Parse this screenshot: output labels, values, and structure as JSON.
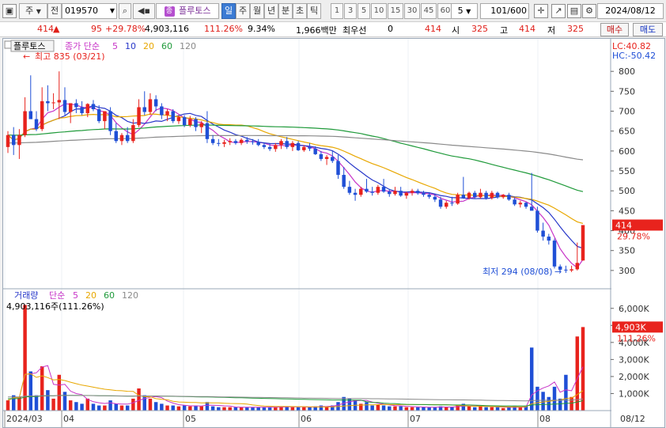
{
  "toolbar": {
    "market_label": "주",
    "prev_label": "전",
    "stock_code": "019570",
    "stock_badge": "종",
    "stock_name": "플루토스",
    "periods": [
      "일",
      "주",
      "월",
      "년",
      "분",
      "초",
      "틱"
    ],
    "active_period": "일",
    "intervals": [
      "1",
      "3",
      "5",
      "10",
      "15",
      "30",
      "45",
      "60"
    ],
    "interval_value": "5",
    "count_value": "101",
    "count_total": "/600",
    "date_value": "2024/08/12"
  },
  "quote": {
    "price": "414",
    "change": "95",
    "change_pct": "+29.78%",
    "volume": "4,903,116",
    "volume_pct": "111.26%",
    "turnover_pct": "9.34%",
    "amount": "1,966백만",
    "pref_label": "최우선",
    "pref_value": "0",
    "bid": "414",
    "open_label": "시",
    "open_value": "325",
    "high_label": "고",
    "high_value": "414",
    "low_label": "저",
    "low_value": "325",
    "buy_button": "매수",
    "sell_button": "매도"
  },
  "price_panel": {
    "legend_name": "플루토스",
    "legend_ma_title": "종가 단순",
    "legend_ma": [
      "5",
      "10",
      "20",
      "60",
      "120"
    ],
    "max_note": "최고 835 (03/21)",
    "min_note": "최저 294 (08/08)",
    "lc_label": "LC:40.82",
    "hc_label": "HC:-50.42",
    "current_price_tag": "414",
    "current_pct_tag": "29.78%"
  },
  "volume_panel": {
    "legend_title": "거래량",
    "legend_ma_title": "단순",
    "legend_ma": [
      "5",
      "20",
      "60",
      "120"
    ],
    "volume_note": "4,903,116주(111.26%)",
    "current_volume_tag": "4,903K",
    "current_pct_tag": "111.26%"
  },
  "colors": {
    "up": "#e8231d",
    "down": "#1f4fd6",
    "ma5": "#c733c7",
    "ma10": "#2737c9",
    "ma20": "#e8a700",
    "ma60": "#1f9a3a",
    "ma120": "#8a8a8a"
  },
  "chart_data": {
    "type": "candlestick",
    "price_axis": {
      "ticks": [
        "300",
        "350",
        "400",
        "450",
        "500",
        "550",
        "600",
        "650",
        "700",
        "750",
        "800"
      ],
      "ylim": [
        262,
        858
      ]
    },
    "volume_axis": {
      "ticks": [
        "1,000K",
        "2,000K",
        "3,000K",
        "4,000K",
        "5,000K",
        "6,000K"
      ],
      "ylim": [
        0,
        6500000
      ]
    },
    "x_ticks": [
      "2024/03",
      "04",
      "05",
      "06",
      "07",
      "08",
      "08/12"
    ],
    "candles": [
      {
        "o": 610,
        "h": 650,
        "l": 595,
        "c": 640,
        "v": 600000
      },
      {
        "o": 640,
        "h": 660,
        "l": 590,
        "c": 615,
        "v": 900000
      },
      {
        "o": 615,
        "h": 655,
        "l": 580,
        "c": 640,
        "v": 800000
      },
      {
        "o": 640,
        "h": 735,
        "l": 635,
        "c": 700,
        "v": 6200000
      },
      {
        "o": 700,
        "h": 790,
        "l": 690,
        "c": 680,
        "v": 2300000
      },
      {
        "o": 680,
        "h": 700,
        "l": 650,
        "c": 655,
        "v": 900000
      },
      {
        "o": 655,
        "h": 760,
        "l": 650,
        "c": 725,
        "v": 2600000
      },
      {
        "o": 725,
        "h": 765,
        "l": 700,
        "c": 720,
        "v": 1200000
      },
      {
        "o": 720,
        "h": 745,
        "l": 705,
        "c": 722,
        "v": 700000
      },
      {
        "o": 722,
        "h": 800,
        "l": 680,
        "c": 728,
        "v": 2100000
      },
      {
        "o": 728,
        "h": 760,
        "l": 690,
        "c": 698,
        "v": 1100000
      },
      {
        "o": 698,
        "h": 720,
        "l": 670,
        "c": 720,
        "v": 600000
      },
      {
        "o": 720,
        "h": 730,
        "l": 695,
        "c": 710,
        "v": 500000
      },
      {
        "o": 710,
        "h": 725,
        "l": 690,
        "c": 695,
        "v": 400000
      },
      {
        "o": 695,
        "h": 720,
        "l": 685,
        "c": 718,
        "v": 700000
      },
      {
        "o": 718,
        "h": 728,
        "l": 700,
        "c": 705,
        "v": 400000
      },
      {
        "o": 705,
        "h": 715,
        "l": 670,
        "c": 675,
        "v": 300000
      },
      {
        "o": 675,
        "h": 700,
        "l": 655,
        "c": 700,
        "v": 300000
      },
      {
        "o": 700,
        "h": 710,
        "l": 640,
        "c": 650,
        "v": 600000
      },
      {
        "o": 650,
        "h": 670,
        "l": 620,
        "c": 625,
        "v": 400000
      },
      {
        "o": 625,
        "h": 645,
        "l": 615,
        "c": 640,
        "v": 300000
      },
      {
        "o": 640,
        "h": 660,
        "l": 620,
        "c": 625,
        "v": 300000
      },
      {
        "o": 625,
        "h": 680,
        "l": 620,
        "c": 665,
        "v": 700000
      },
      {
        "o": 665,
        "h": 730,
        "l": 660,
        "c": 710,
        "v": 1300000
      },
      {
        "o": 710,
        "h": 750,
        "l": 690,
        "c": 698,
        "v": 900000
      },
      {
        "o": 698,
        "h": 745,
        "l": 690,
        "c": 730,
        "v": 700000
      },
      {
        "o": 730,
        "h": 740,
        "l": 700,
        "c": 712,
        "v": 500000
      },
      {
        "o": 712,
        "h": 720,
        "l": 680,
        "c": 690,
        "v": 400000
      },
      {
        "o": 690,
        "h": 705,
        "l": 675,
        "c": 700,
        "v": 300000
      },
      {
        "o": 700,
        "h": 705,
        "l": 670,
        "c": 675,
        "v": 300000
      },
      {
        "o": 675,
        "h": 690,
        "l": 668,
        "c": 685,
        "v": 250000
      },
      {
        "o": 685,
        "h": 690,
        "l": 660,
        "c": 665,
        "v": 300000
      },
      {
        "o": 665,
        "h": 688,
        "l": 660,
        "c": 680,
        "v": 250000
      },
      {
        "o": 680,
        "h": 685,
        "l": 650,
        "c": 660,
        "v": 300000
      },
      {
        "o": 660,
        "h": 675,
        "l": 645,
        "c": 670,
        "v": 250000
      },
      {
        "o": 670,
        "h": 700,
        "l": 620,
        "c": 630,
        "v": 500000
      },
      {
        "o": 630,
        "h": 640,
        "l": 615,
        "c": 620,
        "v": 250000
      },
      {
        "o": 620,
        "h": 630,
        "l": 612,
        "c": 618,
        "v": 200000
      },
      {
        "o": 618,
        "h": 628,
        "l": 610,
        "c": 622,
        "v": 200000
      },
      {
        "o": 622,
        "h": 632,
        "l": 615,
        "c": 625,
        "v": 200000
      },
      {
        "o": 625,
        "h": 630,
        "l": 616,
        "c": 620,
        "v": 200000
      },
      {
        "o": 620,
        "h": 632,
        "l": 615,
        "c": 628,
        "v": 200000
      },
      {
        "o": 628,
        "h": 635,
        "l": 618,
        "c": 624,
        "v": 200000
      },
      {
        "o": 624,
        "h": 630,
        "l": 616,
        "c": 622,
        "v": 200000
      },
      {
        "o": 622,
        "h": 630,
        "l": 612,
        "c": 615,
        "v": 200000
      },
      {
        "o": 615,
        "h": 622,
        "l": 605,
        "c": 610,
        "v": 200000
      },
      {
        "o": 610,
        "h": 618,
        "l": 600,
        "c": 605,
        "v": 200000
      },
      {
        "o": 605,
        "h": 620,
        "l": 598,
        "c": 615,
        "v": 200000
      },
      {
        "o": 615,
        "h": 630,
        "l": 605,
        "c": 625,
        "v": 250000
      },
      {
        "o": 625,
        "h": 635,
        "l": 605,
        "c": 610,
        "v": 250000
      },
      {
        "o": 610,
        "h": 625,
        "l": 600,
        "c": 620,
        "v": 200000
      },
      {
        "o": 620,
        "h": 625,
        "l": 600,
        "c": 602,
        "v": 200000
      },
      {
        "o": 602,
        "h": 615,
        "l": 598,
        "c": 610,
        "v": 200000
      },
      {
        "o": 610,
        "h": 620,
        "l": 600,
        "c": 606,
        "v": 200000
      },
      {
        "o": 606,
        "h": 612,
        "l": 590,
        "c": 592,
        "v": 250000
      },
      {
        "o": 592,
        "h": 600,
        "l": 575,
        "c": 580,
        "v": 300000
      },
      {
        "o": 580,
        "h": 590,
        "l": 565,
        "c": 585,
        "v": 250000
      },
      {
        "o": 585,
        "h": 600,
        "l": 570,
        "c": 575,
        "v": 300000
      },
      {
        "o": 575,
        "h": 590,
        "l": 530,
        "c": 540,
        "v": 500000
      },
      {
        "o": 540,
        "h": 560,
        "l": 505,
        "c": 510,
        "v": 800000
      },
      {
        "o": 510,
        "h": 525,
        "l": 490,
        "c": 495,
        "v": 700000
      },
      {
        "o": 495,
        "h": 505,
        "l": 475,
        "c": 490,
        "v": 600000
      },
      {
        "o": 490,
        "h": 510,
        "l": 485,
        "c": 505,
        "v": 400000
      },
      {
        "o": 505,
        "h": 530,
        "l": 495,
        "c": 498,
        "v": 500000
      },
      {
        "o": 498,
        "h": 510,
        "l": 488,
        "c": 495,
        "v": 300000
      },
      {
        "o": 495,
        "h": 515,
        "l": 490,
        "c": 510,
        "v": 350000
      },
      {
        "o": 510,
        "h": 530,
        "l": 495,
        "c": 498,
        "v": 300000
      },
      {
        "o": 498,
        "h": 505,
        "l": 485,
        "c": 492,
        "v": 250000
      },
      {
        "o": 492,
        "h": 510,
        "l": 488,
        "c": 500,
        "v": 250000
      },
      {
        "o": 500,
        "h": 510,
        "l": 485,
        "c": 488,
        "v": 250000
      },
      {
        "o": 488,
        "h": 498,
        "l": 480,
        "c": 495,
        "v": 200000
      },
      {
        "o": 495,
        "h": 505,
        "l": 488,
        "c": 500,
        "v": 200000
      },
      {
        "o": 500,
        "h": 505,
        "l": 490,
        "c": 494,
        "v": 200000
      },
      {
        "o": 494,
        "h": 500,
        "l": 485,
        "c": 490,
        "v": 200000
      },
      {
        "o": 490,
        "h": 496,
        "l": 480,
        "c": 485,
        "v": 200000
      },
      {
        "o": 485,
        "h": 492,
        "l": 472,
        "c": 478,
        "v": 200000
      },
      {
        "o": 478,
        "h": 485,
        "l": 455,
        "c": 460,
        "v": 250000
      },
      {
        "o": 460,
        "h": 475,
        "l": 455,
        "c": 470,
        "v": 200000
      },
      {
        "o": 470,
        "h": 485,
        "l": 462,
        "c": 468,
        "v": 200000
      },
      {
        "o": 468,
        "h": 495,
        "l": 465,
        "c": 490,
        "v": 300000
      },
      {
        "o": 490,
        "h": 535,
        "l": 480,
        "c": 482,
        "v": 400000
      },
      {
        "o": 482,
        "h": 498,
        "l": 478,
        "c": 495,
        "v": 250000
      },
      {
        "o": 495,
        "h": 500,
        "l": 480,
        "c": 484,
        "v": 200000
      },
      {
        "o": 484,
        "h": 505,
        "l": 480,
        "c": 495,
        "v": 300000
      },
      {
        "o": 495,
        "h": 500,
        "l": 478,
        "c": 482,
        "v": 200000
      },
      {
        "o": 482,
        "h": 500,
        "l": 478,
        "c": 495,
        "v": 200000
      },
      {
        "o": 495,
        "h": 498,
        "l": 480,
        "c": 484,
        "v": 200000
      },
      {
        "o": 484,
        "h": 492,
        "l": 480,
        "c": 490,
        "v": 150000
      },
      {
        "o": 490,
        "h": 495,
        "l": 475,
        "c": 478,
        "v": 200000
      },
      {
        "o": 478,
        "h": 484,
        "l": 462,
        "c": 466,
        "v": 250000
      },
      {
        "o": 466,
        "h": 475,
        "l": 458,
        "c": 470,
        "v": 200000
      },
      {
        "o": 470,
        "h": 472,
        "l": 455,
        "c": 460,
        "v": 250000
      },
      {
        "o": 460,
        "h": 545,
        "l": 452,
        "c": 450,
        "v": 3700000
      },
      {
        "o": 450,
        "h": 460,
        "l": 395,
        "c": 400,
        "v": 1400000
      },
      {
        "o": 400,
        "h": 420,
        "l": 375,
        "c": 385,
        "v": 1100000
      },
      {
        "o": 385,
        "h": 392,
        "l": 365,
        "c": 375,
        "v": 800000
      },
      {
        "o": 375,
        "h": 380,
        "l": 305,
        "c": 310,
        "v": 1400000
      },
      {
        "o": 310,
        "h": 315,
        "l": 300,
        "c": 302,
        "v": 700000
      },
      {
        "o": 302,
        "h": 312,
        "l": 294,
        "c": 300,
        "v": 2100000
      },
      {
        "o": 300,
        "h": 312,
        "l": 296,
        "c": 303,
        "v": 800000
      },
      {
        "o": 303,
        "h": 370,
        "l": 300,
        "c": 319,
        "v": 4350000
      },
      {
        "o": 325,
        "h": 414,
        "l": 325,
        "c": 414,
        "v": 4903116
      }
    ],
    "series": [
      {
        "name": "5",
        "type": "ma"
      },
      {
        "name": "10",
        "type": "ma"
      },
      {
        "name": "20",
        "type": "ma"
      },
      {
        "name": "60",
        "type": "ma"
      },
      {
        "name": "120",
        "type": "ma"
      }
    ]
  }
}
